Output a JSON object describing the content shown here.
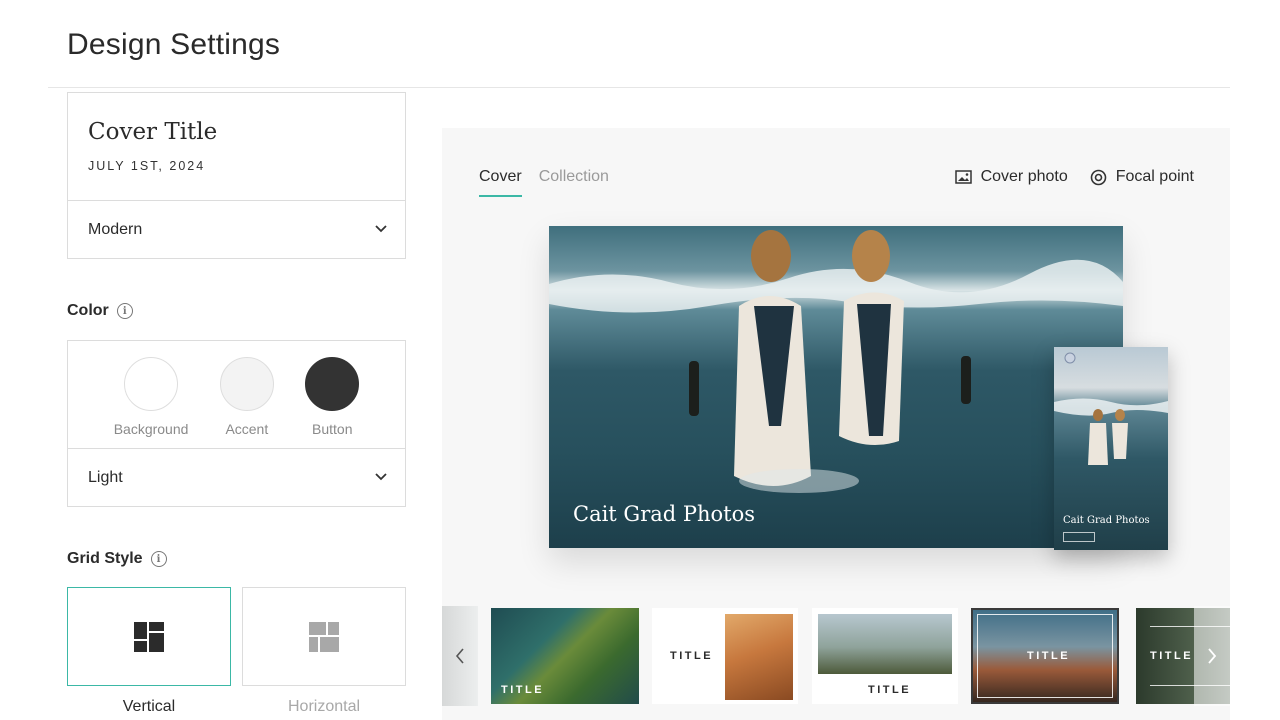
{
  "page": {
    "title": "Design Settings"
  },
  "cover_title": {
    "title": "Cover Title",
    "date": "JULY 1ST, 2024",
    "font_style": "Modern"
  },
  "color": {
    "label": "Color",
    "swatches": [
      {
        "label": "Background",
        "color": "#ffffff"
      },
      {
        "label": "Accent",
        "color": "#f3f3f3"
      },
      {
        "label": "Button",
        "color": "#333333"
      }
    ],
    "theme": "Light"
  },
  "grid_style": {
    "label": "Grid Style",
    "options": [
      {
        "label": "Vertical",
        "selected": true
      },
      {
        "label": "Horizontal",
        "selected": false
      }
    ]
  },
  "preview": {
    "tabs": [
      {
        "label": "Cover",
        "active": true
      },
      {
        "label": "Collection",
        "active": false
      }
    ],
    "actions": {
      "cover_photo": "Cover photo",
      "focal_point": "Focal point"
    },
    "hero_title": "Cait Grad Photos",
    "mobile_title": "Cait Grad Photos",
    "accent_color": "#3bb8a6"
  },
  "cover_layouts": {
    "items": [
      {
        "title": "TITLE"
      },
      {
        "title": "TITLE"
      },
      {
        "title": "TITLE"
      },
      {
        "title": "TITLE"
      },
      {
        "title": "TITLE"
      }
    ]
  }
}
